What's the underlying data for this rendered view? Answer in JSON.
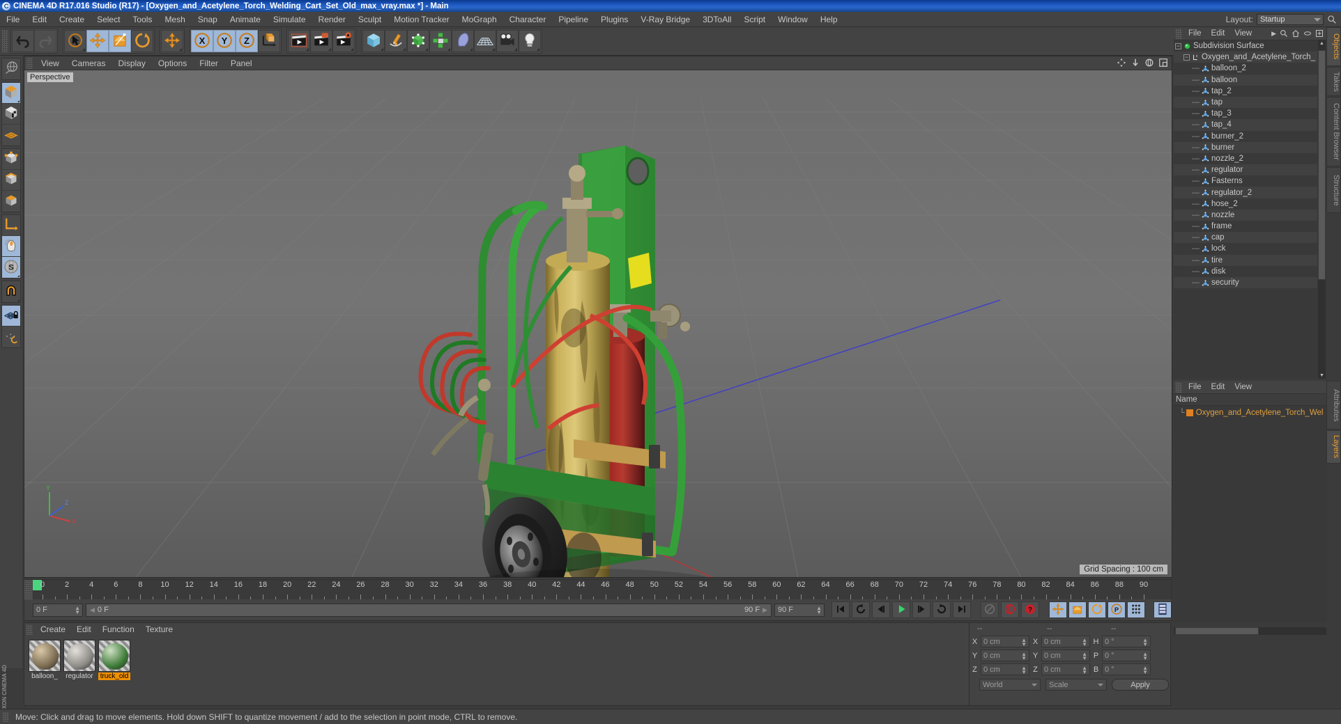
{
  "titlebar": {
    "text": "CINEMA 4D R17.016 Studio (R17) - [Oxygen_and_Acetylene_Torch_Welding_Cart_Set_Old_max_vray.max *] - Main",
    "logo": "c4d-logo-icon"
  },
  "menubar": {
    "items": [
      "File",
      "Edit",
      "Create",
      "Select",
      "Tools",
      "Mesh",
      "Snap",
      "Animate",
      "Simulate",
      "Render",
      "Sculpt",
      "Motion Tracker",
      "MoGraph",
      "Character",
      "Pipeline",
      "Plugins",
      "V-Ray Bridge",
      "3DToAll",
      "Script",
      "Window",
      "Help"
    ],
    "layout_label": "Layout:",
    "layout_value": "Startup",
    "search_icon": "magnifier-icon"
  },
  "toolbar": {
    "groups": [
      {
        "name": "history",
        "buttons": [
          {
            "icon": "undo-icon",
            "active": false,
            "dim": false,
            "corner": false
          },
          {
            "icon": "redo-icon",
            "active": false,
            "dim": true,
            "corner": false
          }
        ]
      },
      {
        "name": "transform-tools",
        "buttons": [
          {
            "icon": "select-live-icon",
            "active": false,
            "dim": false,
            "corner": true
          },
          {
            "icon": "move-icon",
            "active": true,
            "dim": false,
            "corner": false
          },
          {
            "icon": "scale-icon",
            "active": true,
            "dim": false,
            "corner": false
          },
          {
            "icon": "rotate-icon",
            "active": false,
            "dim": false,
            "corner": false
          }
        ]
      },
      {
        "name": "move-dup",
        "buttons": [
          {
            "icon": "move-icon",
            "active": false,
            "dim": false,
            "corner": true
          }
        ]
      },
      {
        "name": "axis-locks",
        "buttons": [
          {
            "icon": "axis-x-icon",
            "active": true,
            "dim": false,
            "corner": false
          },
          {
            "icon": "axis-y-icon",
            "active": true,
            "dim": false,
            "corner": false
          },
          {
            "icon": "axis-z-icon",
            "active": true,
            "dim": false,
            "corner": false
          },
          {
            "icon": "world-coord-icon",
            "active": false,
            "dim": false,
            "corner": false
          }
        ]
      },
      {
        "name": "render-group",
        "buttons": [
          {
            "icon": "render-view-icon",
            "active": false,
            "dim": false,
            "corner": true
          },
          {
            "icon": "render-picture-viewer-icon",
            "active": false,
            "dim": false,
            "corner": true
          },
          {
            "icon": "render-settings-icon",
            "active": false,
            "dim": false,
            "corner": true
          }
        ]
      },
      {
        "name": "create-group",
        "buttons": [
          {
            "icon": "cube-primitive-icon",
            "active": false,
            "dim": false,
            "corner": true
          },
          {
            "icon": "spline-pen-icon",
            "active": false,
            "dim": false,
            "corner": true
          },
          {
            "icon": "generator-nurbs-icon",
            "active": false,
            "dim": false,
            "corner": true
          },
          {
            "icon": "mograph-cloner-icon",
            "active": false,
            "dim": false,
            "corner": true
          },
          {
            "icon": "deformer-bend-icon",
            "active": false,
            "dim": false,
            "corner": true
          },
          {
            "icon": "scene-floor-icon",
            "active": false,
            "dim": false,
            "corner": true
          },
          {
            "icon": "camera-icon",
            "active": false,
            "dim": false,
            "corner": true
          },
          {
            "icon": "light-icon",
            "active": false,
            "dim": false,
            "corner": true
          }
        ]
      }
    ]
  },
  "left_toolbar": {
    "groups": [
      {
        "buttons": [
          {
            "icon": "undo-world-axis-icon",
            "active": false,
            "corner": false
          }
        ]
      },
      {
        "buttons": [
          {
            "icon": "make-editable-icon",
            "active": true,
            "corner": true
          },
          {
            "icon": "model-mode-icon",
            "active": false,
            "corner": false
          },
          {
            "icon": "texture-mode-icon",
            "active": false,
            "corner": false
          }
        ]
      },
      {
        "buttons": [
          {
            "icon": "points-mode-icon",
            "active": false,
            "corner": false
          },
          {
            "icon": "edges-mode-icon",
            "active": false,
            "corner": false
          },
          {
            "icon": "polygons-mode-icon",
            "active": false,
            "corner": false
          }
        ]
      },
      {
        "buttons": [
          {
            "icon": "axis-modify-icon",
            "active": false,
            "corner": false
          },
          {
            "icon": "viewport-solo-icon",
            "active": true,
            "corner": false
          },
          {
            "icon": "enable-snap-s-icon",
            "active": true,
            "corner": true
          }
        ]
      },
      {
        "buttons": [
          {
            "icon": "magnet-icon",
            "active": false,
            "corner": true
          }
        ]
      },
      {
        "buttons": [
          {
            "icon": "workplane-lock-icon",
            "active": true,
            "corner": false
          },
          {
            "icon": "workplane-rotate-icon",
            "active": false,
            "corner": false
          }
        ]
      }
    ],
    "brand_line1": "MAXON",
    "brand_line2": "CINEMA 4D"
  },
  "viewport": {
    "menu_items": [
      "View",
      "Cameras",
      "Display",
      "Options",
      "Filter",
      "Panel"
    ],
    "perspective_label": "Perspective",
    "grid_spacing": "Grid Spacing : 100 cm",
    "corner_icons": [
      "viewport-pan-icon",
      "viewport-dolly-icon",
      "viewport-rotate-icon",
      "viewport-maximize-icon"
    ],
    "axis_gizmo": {
      "x": "X",
      "y": "Y",
      "z": "Z"
    }
  },
  "timeline": {
    "ticks": [
      0,
      2,
      4,
      6,
      8,
      10,
      12,
      14,
      16,
      18,
      20,
      22,
      24,
      26,
      28,
      30,
      32,
      34,
      36,
      38,
      40,
      42,
      44,
      46,
      48,
      50,
      52,
      54,
      56,
      58,
      60,
      62,
      64,
      66,
      68,
      70,
      72,
      74,
      76,
      78,
      80,
      82,
      84,
      86,
      88,
      90
    ],
    "current_frame_field": "0 F",
    "preview_min_field": "0 F",
    "preview_max_field": "90 F",
    "end_frame_field": "90 F",
    "fps_field": "0 F",
    "transport": [
      {
        "icon": "go-to-start-icon",
        "style": "dark"
      },
      {
        "icon": "play-backward-loop-icon",
        "style": "dark"
      },
      {
        "icon": "step-back-icon",
        "style": "dark"
      },
      {
        "icon": "play-forward-icon",
        "style": "dark"
      },
      {
        "icon": "step-forward-icon",
        "style": "dark"
      },
      {
        "icon": "loop-icon",
        "style": "dark"
      },
      {
        "icon": "go-to-end-icon",
        "style": "dark"
      }
    ],
    "record_tools": [
      {
        "icon": "autokey-icon",
        "style": "dim"
      },
      {
        "icon": "record-active-objects-icon",
        "style": "dark"
      },
      {
        "icon": "keyframe-selection-icon",
        "style": "dark"
      }
    ],
    "key_toggles": [
      {
        "icon": "key-position-icon",
        "style": "blue"
      },
      {
        "icon": "key-scale-icon",
        "style": "blue"
      },
      {
        "icon": "key-rotation-icon",
        "style": "blue"
      },
      {
        "icon": "key-parameter-icon",
        "style": "blue"
      },
      {
        "icon": "key-pla-icon",
        "style": "blue"
      }
    ],
    "timeline_button": {
      "icon": "timeline-icon",
      "style": "blue"
    }
  },
  "material_manager": {
    "menu_items": [
      "Create",
      "Edit",
      "Function",
      "Texture"
    ],
    "materials": [
      {
        "name": "balloon_",
        "selected": false,
        "color1": "#d9c8a8",
        "color2": "#7a6a50"
      },
      {
        "name": "regulator",
        "selected": false,
        "color1": "#e3e0da",
        "color2": "#8c8a85"
      },
      {
        "name": "truck_old",
        "selected": true,
        "color1": "#cfe0c4",
        "color2": "#3c7a36"
      }
    ]
  },
  "coordinates": {
    "header_dashes": [
      "--",
      "--",
      "--"
    ],
    "rows": [
      {
        "l1": "X",
        "v1": "0 cm",
        "l2": "X",
        "v2": "0 cm",
        "l3": "H",
        "v3": "0 °"
      },
      {
        "l1": "Y",
        "v1": "0 cm",
        "l2": "Y",
        "v2": "0 cm",
        "l3": "P",
        "v3": "0 °"
      },
      {
        "l1": "Z",
        "v1": "0 cm",
        "l2": "Z",
        "v2": "0 cm",
        "l3": "B",
        "v3": "0 °"
      }
    ],
    "system": "World",
    "mode": "Scale",
    "apply": "Apply"
  },
  "object_manager": {
    "menu_items": [
      "File",
      "Edit",
      "View"
    ],
    "menu_icons": [
      "chevron-right-icon",
      "search-icon",
      "home-icon",
      "ellipse-icon",
      "plus-box-icon"
    ],
    "items": [
      {
        "label": "Subdivision Surface",
        "depth": 0,
        "type": "generator",
        "expander": true
      },
      {
        "label": "Oxygen_and_Acetylene_Torch_",
        "depth": 1,
        "type": "null",
        "expander": true
      },
      {
        "label": "balloon_2",
        "depth": 2,
        "type": "polygon",
        "expander": false
      },
      {
        "label": "balloon",
        "depth": 2,
        "type": "polygon",
        "expander": false
      },
      {
        "label": "tap_2",
        "depth": 2,
        "type": "polygon",
        "expander": false
      },
      {
        "label": "tap",
        "depth": 2,
        "type": "polygon",
        "expander": false
      },
      {
        "label": "tap_3",
        "depth": 2,
        "type": "polygon",
        "expander": false
      },
      {
        "label": "tap_4",
        "depth": 2,
        "type": "polygon",
        "expander": false
      },
      {
        "label": "burner_2",
        "depth": 2,
        "type": "polygon",
        "expander": false
      },
      {
        "label": "burner",
        "depth": 2,
        "type": "polygon",
        "expander": false
      },
      {
        "label": "nozzle_2",
        "depth": 2,
        "type": "polygon",
        "expander": false
      },
      {
        "label": "regulator",
        "depth": 2,
        "type": "polygon",
        "expander": false
      },
      {
        "label": "Fasterns",
        "depth": 2,
        "type": "polygon",
        "expander": false
      },
      {
        "label": "regulator_2",
        "depth": 2,
        "type": "polygon",
        "expander": false
      },
      {
        "label": "hose_2",
        "depth": 2,
        "type": "polygon",
        "expander": false
      },
      {
        "label": "nozzle",
        "depth": 2,
        "type": "polygon",
        "expander": false
      },
      {
        "label": "frame",
        "depth": 2,
        "type": "polygon",
        "expander": false
      },
      {
        "label": "cap",
        "depth": 2,
        "type": "polygon",
        "expander": false
      },
      {
        "label": "lock",
        "depth": 2,
        "type": "polygon",
        "expander": false
      },
      {
        "label": "tire",
        "depth": 2,
        "type": "polygon",
        "expander": false
      },
      {
        "label": "disk",
        "depth": 2,
        "type": "polygon",
        "expander": false
      },
      {
        "label": "security",
        "depth": 2,
        "type": "polygon",
        "expander": false
      }
    ],
    "tabs": [
      {
        "label": "Objects",
        "active": true
      },
      {
        "label": "Takes",
        "active": false
      },
      {
        "label": "Content Browser",
        "active": false
      },
      {
        "label": "Structure",
        "active": false
      }
    ]
  },
  "layer_manager": {
    "menu_items": [
      "File",
      "Edit",
      "View"
    ],
    "column_header": "Name",
    "row_label": "Oxygen_and_Acetylene_Torch_Wel",
    "row_color": "#e08020",
    "tabs": [
      {
        "label": "Attributes",
        "active": false
      },
      {
        "label": "Layers",
        "active": true
      }
    ]
  },
  "statusbar": {
    "text": "Move: Click and drag to move elements. Hold down SHIFT to quantize movement / add to the selection in point mode, CTRL to remove."
  }
}
